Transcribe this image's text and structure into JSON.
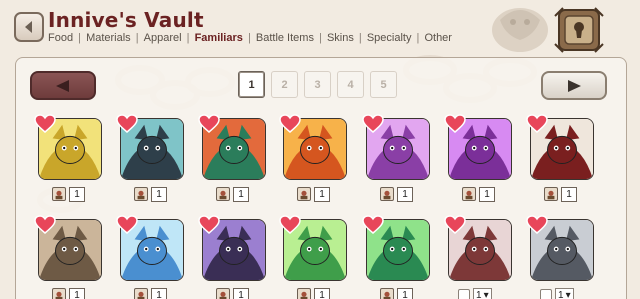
{
  "header": {
    "title": "Innive's Vault",
    "categories": [
      {
        "label": "Food",
        "active": false
      },
      {
        "label": "Materials",
        "active": false
      },
      {
        "label": "Apparel",
        "active": false
      },
      {
        "label": "Familiars",
        "active": true
      },
      {
        "label": "Battle Items",
        "active": false
      },
      {
        "label": "Skins",
        "active": false
      },
      {
        "label": "Specialty",
        "active": false
      },
      {
        "label": "Other",
        "active": false
      }
    ],
    "separator": "|"
  },
  "pagination": {
    "pages": [
      "1",
      "2",
      "3",
      "4",
      "5"
    ],
    "current": "1"
  },
  "familiars": [
    {
      "row": 0,
      "count": "1",
      "control": "count",
      "colors": [
        "#c9a62a",
        "#f2e27a"
      ]
    },
    {
      "row": 0,
      "count": "1",
      "control": "count",
      "colors": [
        "#2e3f4a",
        "#7fc4c8"
      ]
    },
    {
      "row": 0,
      "count": "1",
      "control": "count",
      "colors": [
        "#2b7d5b",
        "#e36a3c"
      ]
    },
    {
      "row": 0,
      "count": "1",
      "control": "count",
      "colors": [
        "#d5561f",
        "#f7b24a"
      ]
    },
    {
      "row": 0,
      "count": "1",
      "control": "count",
      "colors": [
        "#8a3fa6",
        "#e2a6f0"
      ]
    },
    {
      "row": 0,
      "count": "1",
      "control": "count",
      "colors": [
        "#7b2f99",
        "#d78af2"
      ]
    },
    {
      "row": 0,
      "count": "1",
      "control": "count",
      "colors": [
        "#7a1f1f",
        "#efe6dc"
      ]
    },
    {
      "row": 1,
      "count": "1",
      "control": "count",
      "colors": [
        "#6e5a45",
        "#cbb59a"
      ]
    },
    {
      "row": 1,
      "count": "1",
      "control": "count",
      "colors": [
        "#4a8fd0",
        "#bfe6f7"
      ]
    },
    {
      "row": 1,
      "count": "1",
      "control": "count",
      "colors": [
        "#3a2e55",
        "#9b7fd0"
      ]
    },
    {
      "row": 1,
      "count": "1",
      "control": "count",
      "colors": [
        "#3f9e4a",
        "#b9ef92"
      ]
    },
    {
      "row": 1,
      "count": "1",
      "control": "count",
      "colors": [
        "#2a8a52",
        "#8fe28a"
      ]
    },
    {
      "row": 1,
      "count": "1",
      "control": "select",
      "colors": [
        "#7d3838",
        "#e8d5d5"
      ]
    },
    {
      "row": 1,
      "count": "1",
      "control": "select",
      "colors": [
        "#555a63",
        "#c9cdd3"
      ]
    }
  ],
  "icons": {
    "back": "back-arrow-icon",
    "prev": "left-arrow-icon",
    "next": "right-arrow-icon",
    "heart": "heart-icon",
    "bond": "bond-icon",
    "vault": "vault-lock-icon"
  },
  "colors": {
    "title": "#6b2222",
    "background": "#f2ebe1",
    "prev_button": "#7a4747",
    "heart": "#e8465a"
  }
}
